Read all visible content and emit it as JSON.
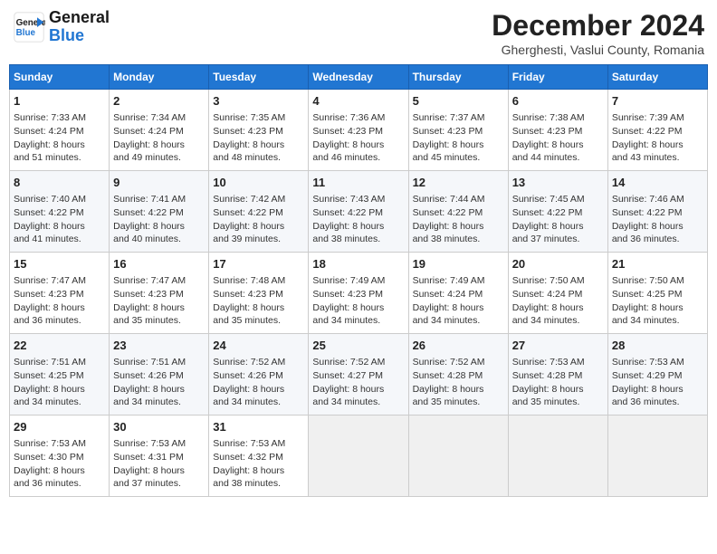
{
  "header": {
    "logo_line1": "General",
    "logo_line2": "Blue",
    "month_title": "December 2024",
    "location": "Gherghesti, Vaslui County, Romania"
  },
  "weekdays": [
    "Sunday",
    "Monday",
    "Tuesday",
    "Wednesday",
    "Thursday",
    "Friday",
    "Saturday"
  ],
  "weeks": [
    [
      {
        "day": "1",
        "info": "Sunrise: 7:33 AM\nSunset: 4:24 PM\nDaylight: 8 hours\nand 51 minutes."
      },
      {
        "day": "2",
        "info": "Sunrise: 7:34 AM\nSunset: 4:24 PM\nDaylight: 8 hours\nand 49 minutes."
      },
      {
        "day": "3",
        "info": "Sunrise: 7:35 AM\nSunset: 4:23 PM\nDaylight: 8 hours\nand 48 minutes."
      },
      {
        "day": "4",
        "info": "Sunrise: 7:36 AM\nSunset: 4:23 PM\nDaylight: 8 hours\nand 46 minutes."
      },
      {
        "day": "5",
        "info": "Sunrise: 7:37 AM\nSunset: 4:23 PM\nDaylight: 8 hours\nand 45 minutes."
      },
      {
        "day": "6",
        "info": "Sunrise: 7:38 AM\nSunset: 4:23 PM\nDaylight: 8 hours\nand 44 minutes."
      },
      {
        "day": "7",
        "info": "Sunrise: 7:39 AM\nSunset: 4:22 PM\nDaylight: 8 hours\nand 43 minutes."
      }
    ],
    [
      {
        "day": "8",
        "info": "Sunrise: 7:40 AM\nSunset: 4:22 PM\nDaylight: 8 hours\nand 41 minutes."
      },
      {
        "day": "9",
        "info": "Sunrise: 7:41 AM\nSunset: 4:22 PM\nDaylight: 8 hours\nand 40 minutes."
      },
      {
        "day": "10",
        "info": "Sunrise: 7:42 AM\nSunset: 4:22 PM\nDaylight: 8 hours\nand 39 minutes."
      },
      {
        "day": "11",
        "info": "Sunrise: 7:43 AM\nSunset: 4:22 PM\nDaylight: 8 hours\nand 38 minutes."
      },
      {
        "day": "12",
        "info": "Sunrise: 7:44 AM\nSunset: 4:22 PM\nDaylight: 8 hours\nand 38 minutes."
      },
      {
        "day": "13",
        "info": "Sunrise: 7:45 AM\nSunset: 4:22 PM\nDaylight: 8 hours\nand 37 minutes."
      },
      {
        "day": "14",
        "info": "Sunrise: 7:46 AM\nSunset: 4:22 PM\nDaylight: 8 hours\nand 36 minutes."
      }
    ],
    [
      {
        "day": "15",
        "info": "Sunrise: 7:47 AM\nSunset: 4:23 PM\nDaylight: 8 hours\nand 36 minutes."
      },
      {
        "day": "16",
        "info": "Sunrise: 7:47 AM\nSunset: 4:23 PM\nDaylight: 8 hours\nand 35 minutes."
      },
      {
        "day": "17",
        "info": "Sunrise: 7:48 AM\nSunset: 4:23 PM\nDaylight: 8 hours\nand 35 minutes."
      },
      {
        "day": "18",
        "info": "Sunrise: 7:49 AM\nSunset: 4:23 PM\nDaylight: 8 hours\nand 34 minutes."
      },
      {
        "day": "19",
        "info": "Sunrise: 7:49 AM\nSunset: 4:24 PM\nDaylight: 8 hours\nand 34 minutes."
      },
      {
        "day": "20",
        "info": "Sunrise: 7:50 AM\nSunset: 4:24 PM\nDaylight: 8 hours\nand 34 minutes."
      },
      {
        "day": "21",
        "info": "Sunrise: 7:50 AM\nSunset: 4:25 PM\nDaylight: 8 hours\nand 34 minutes."
      }
    ],
    [
      {
        "day": "22",
        "info": "Sunrise: 7:51 AM\nSunset: 4:25 PM\nDaylight: 8 hours\nand 34 minutes."
      },
      {
        "day": "23",
        "info": "Sunrise: 7:51 AM\nSunset: 4:26 PM\nDaylight: 8 hours\nand 34 minutes."
      },
      {
        "day": "24",
        "info": "Sunrise: 7:52 AM\nSunset: 4:26 PM\nDaylight: 8 hours\nand 34 minutes."
      },
      {
        "day": "25",
        "info": "Sunrise: 7:52 AM\nSunset: 4:27 PM\nDaylight: 8 hours\nand 34 minutes."
      },
      {
        "day": "26",
        "info": "Sunrise: 7:52 AM\nSunset: 4:28 PM\nDaylight: 8 hours\nand 35 minutes."
      },
      {
        "day": "27",
        "info": "Sunrise: 7:53 AM\nSunset: 4:28 PM\nDaylight: 8 hours\nand 35 minutes."
      },
      {
        "day": "28",
        "info": "Sunrise: 7:53 AM\nSunset: 4:29 PM\nDaylight: 8 hours\nand 36 minutes."
      }
    ],
    [
      {
        "day": "29",
        "info": "Sunrise: 7:53 AM\nSunset: 4:30 PM\nDaylight: 8 hours\nand 36 minutes."
      },
      {
        "day": "30",
        "info": "Sunrise: 7:53 AM\nSunset: 4:31 PM\nDaylight: 8 hours\nand 37 minutes."
      },
      {
        "day": "31",
        "info": "Sunrise: 7:53 AM\nSunset: 4:32 PM\nDaylight: 8 hours\nand 38 minutes."
      },
      null,
      null,
      null,
      null
    ]
  ]
}
